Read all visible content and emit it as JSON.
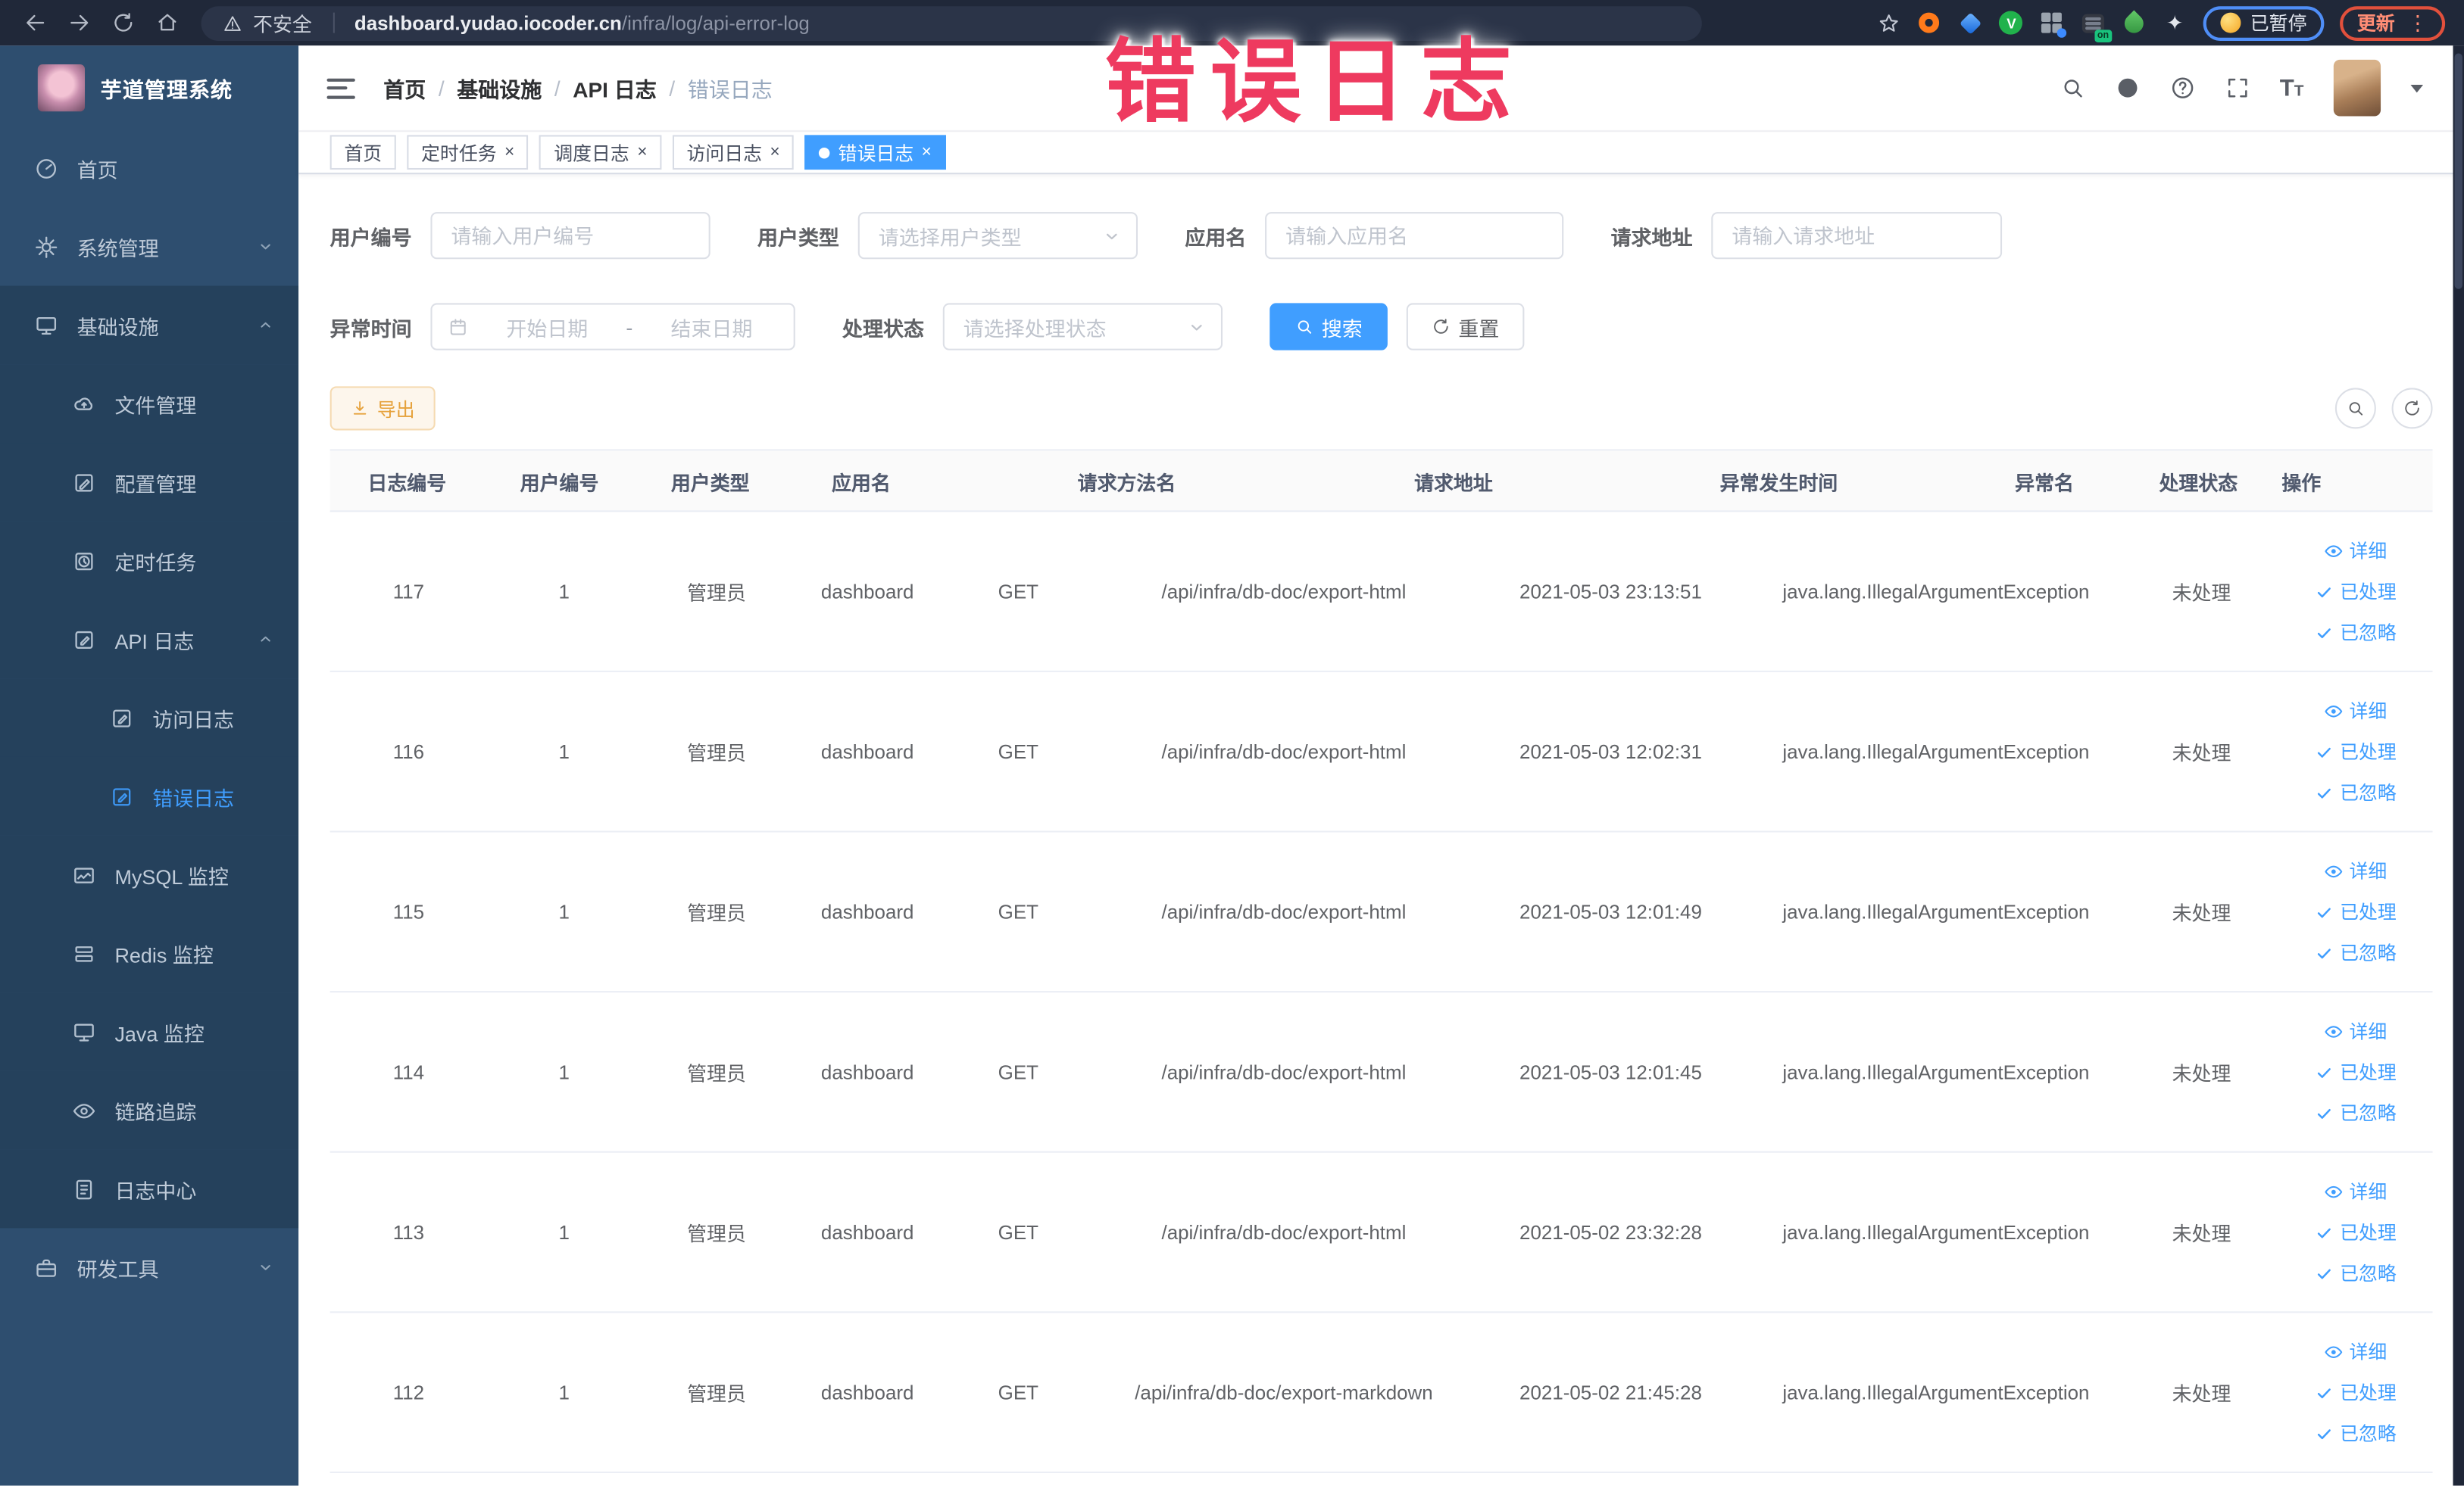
{
  "colors": {
    "accent": "#409EFF",
    "warning": "#E6A23C",
    "annotation": "#EE3A5F",
    "sidebar_bg": "#2E4E6F",
    "sidebar_sub_bg": "#25415C",
    "browser_bg": "#202839"
  },
  "ui": {
    "close": "×",
    "kebab": "⋮",
    "ext_star": "✦",
    "green_badge": "V",
    "on_badge": "on",
    "font_icon_big": "T",
    "font_icon_small": "T",
    "breadcrumb_sep": "/"
  },
  "browser": {
    "security_label": "不安全",
    "url_domain": "dashboard.yudao.iocoder.cn",
    "url_path": "/infra/log/api-error-log",
    "paused_chip": "已暂停",
    "update_button": "更新"
  },
  "annotation": {
    "text": "错误日志"
  },
  "sidebar": {
    "title": "芋道管理系统",
    "items": [
      {
        "label": "首页",
        "icon": "speedo",
        "level": 1
      },
      {
        "label": "系统管理",
        "icon": "gear",
        "level": 1,
        "chevron": "down"
      },
      {
        "label": "基础设施",
        "icon": "monitor",
        "level": 1,
        "chevron": "up",
        "dark": true
      },
      {
        "label": "文件管理",
        "icon": "cloud",
        "level": 2,
        "dark": true
      },
      {
        "label": "配置管理",
        "icon": "edit",
        "level": 2,
        "dark": true
      },
      {
        "label": "定时任务",
        "icon": "clock",
        "level": 2,
        "dark": true
      },
      {
        "label": "API 日志",
        "icon": "logdoc",
        "level": 2,
        "chevron": "up",
        "dark": true
      },
      {
        "label": "访问日志",
        "icon": "logdoc",
        "level": 3,
        "dark": true
      },
      {
        "label": "错误日志",
        "icon": "logdoc",
        "level": 3,
        "dark": true,
        "active": true
      },
      {
        "label": "MySQL 监控",
        "icon": "chart",
        "level": 2,
        "dark": true
      },
      {
        "label": "Redis 监控",
        "icon": "stack",
        "level": 2,
        "dark": true
      },
      {
        "label": "Java 监控",
        "icon": "monitor",
        "level": 2,
        "dark": true
      },
      {
        "label": "链路追踪",
        "icon": "eye",
        "level": 2,
        "dark": true
      },
      {
        "label": "日志中心",
        "icon": "doc",
        "level": 2,
        "dark": true
      },
      {
        "label": "研发工具",
        "icon": "case",
        "level": 1,
        "chevron": "down"
      }
    ]
  },
  "header": {
    "breadcrumb": [
      "首页",
      "基础设施",
      "API 日志",
      "错误日志"
    ]
  },
  "tabs": [
    {
      "label": "首页"
    },
    {
      "label": "定时任务",
      "closable": true
    },
    {
      "label": "调度日志",
      "closable": true
    },
    {
      "label": "访问日志",
      "closable": true
    },
    {
      "label": "错误日志",
      "closable": true,
      "active": true
    }
  ],
  "filters": {
    "user_id": {
      "label": "用户编号",
      "placeholder": "请输入用户编号"
    },
    "user_type": {
      "label": "用户类型",
      "placeholder": "请选择用户类型"
    },
    "app_name": {
      "label": "应用名",
      "placeholder": "请输入应用名"
    },
    "request_url": {
      "label": "请求地址",
      "placeholder": "请输入请求地址"
    },
    "exception_time": {
      "label": "异常时间",
      "start_placeholder": "开始日期",
      "separator": "-",
      "end_placeholder": "结束日期"
    },
    "process_status": {
      "label": "处理状态",
      "placeholder": "请选择处理状态"
    },
    "search_label": "搜索",
    "reset_label": "重置"
  },
  "toolbar": {
    "export_label": "导出"
  },
  "table": {
    "columns": [
      {
        "label": "日志编号"
      },
      {
        "label": "用户编号"
      },
      {
        "label": "用户类型"
      },
      {
        "label": "应用名"
      },
      {
        "label": "请求方法名"
      },
      {
        "label": "请求地址"
      },
      {
        "label": "异常发生时间"
      },
      {
        "label": "异常名"
      },
      {
        "label": "处理状态"
      },
      {
        "label": "操作"
      }
    ],
    "actions": [
      "详细",
      "已处理",
      "已忽略"
    ],
    "rows": [
      {
        "id": "117",
        "user_id": "1",
        "user_type": "管理员",
        "app": "dashboard",
        "method": "GET",
        "url": "/api/infra/db-doc/export-html",
        "time": "2021-05-03 23:13:51",
        "exception": "java.lang.IllegalArgumentException",
        "status": "未处理"
      },
      {
        "id": "116",
        "user_id": "1",
        "user_type": "管理员",
        "app": "dashboard",
        "method": "GET",
        "url": "/api/infra/db-doc/export-html",
        "time": "2021-05-03 12:02:31",
        "exception": "java.lang.IllegalArgumentException",
        "status": "未处理"
      },
      {
        "id": "115",
        "user_id": "1",
        "user_type": "管理员",
        "app": "dashboard",
        "method": "GET",
        "url": "/api/infra/db-doc/export-html",
        "time": "2021-05-03 12:01:49",
        "exception": "java.lang.IllegalArgumentException",
        "status": "未处理"
      },
      {
        "id": "114",
        "user_id": "1",
        "user_type": "管理员",
        "app": "dashboard",
        "method": "GET",
        "url": "/api/infra/db-doc/export-html",
        "time": "2021-05-03 12:01:45",
        "exception": "java.lang.IllegalArgumentException",
        "status": "未处理"
      },
      {
        "id": "113",
        "user_id": "1",
        "user_type": "管理员",
        "app": "dashboard",
        "method": "GET",
        "url": "/api/infra/db-doc/export-html",
        "time": "2021-05-02 23:32:28",
        "exception": "java.lang.IllegalArgumentException",
        "status": "未处理"
      },
      {
        "id": "112",
        "user_id": "1",
        "user_type": "管理员",
        "app": "dashboard",
        "method": "GET",
        "url": "/api/infra/db-doc/export-markdown",
        "time": "2021-05-02 21:45:28",
        "exception": "java.lang.IllegalArgumentException",
        "status": "未处理"
      }
    ]
  }
}
